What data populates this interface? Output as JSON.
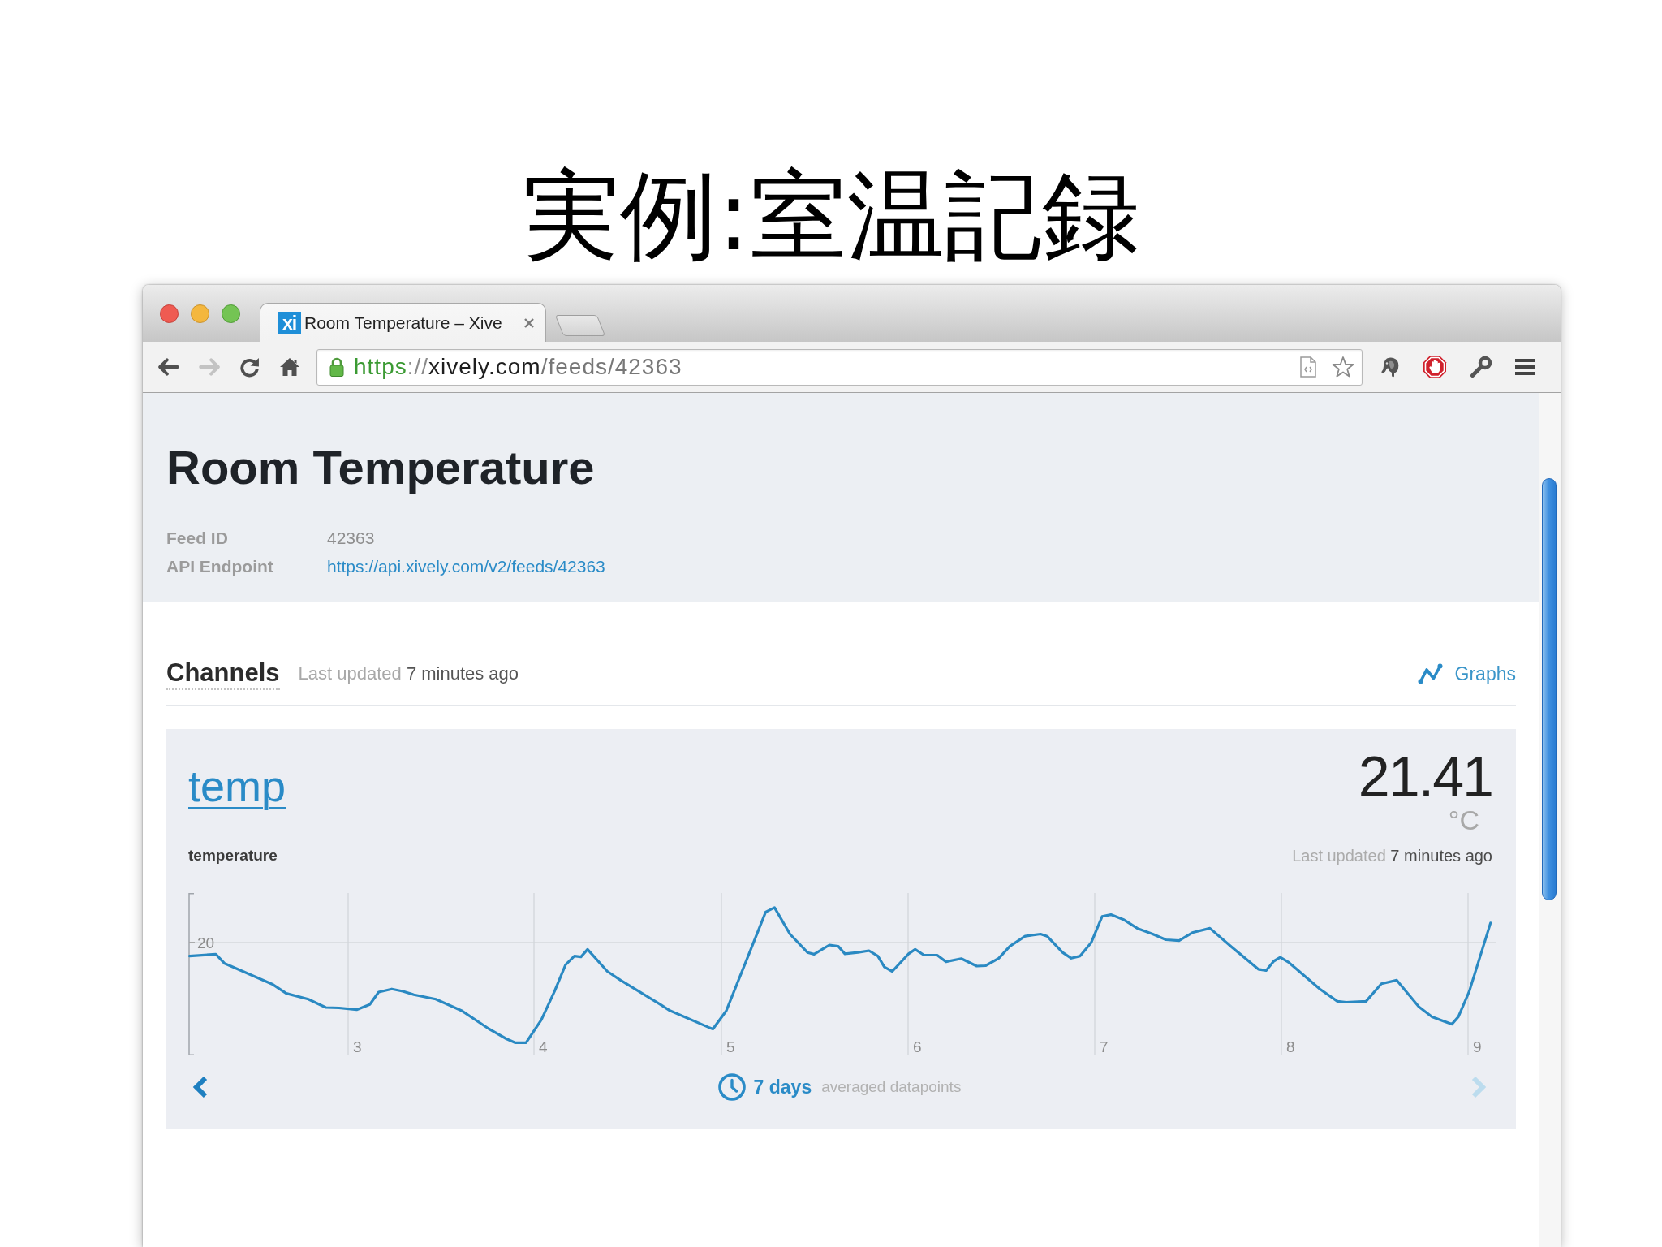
{
  "slide_title": "実例:室温記録",
  "browser": {
    "tabs": [
      {
        "title": "Room Temperature – Xive",
        "favicon": "xi",
        "selected": true
      }
    ],
    "nav_buttons": [
      {
        "kind": "back",
        "disabled": false
      },
      {
        "kind": "forward",
        "disabled": true
      },
      {
        "kind": "reload",
        "disabled": false
      },
      {
        "kind": "home",
        "disabled": false
      }
    ],
    "url_parts": [
      {
        "kind": "scheme",
        "text": "https"
      },
      {
        "kind": "separator",
        "text": "://"
      },
      {
        "kind": "host",
        "text": "xively.com"
      },
      {
        "kind": "path",
        "text": "/feeds/42363"
      }
    ]
  },
  "page": {
    "title": "Room Temperature",
    "fields": [
      {
        "label": "Feed ID",
        "value": "42363",
        "kind": "text"
      },
      {
        "label": "API Endpoint",
        "value": "https://api.xively.com/v2/feeds/42363",
        "kind": "link"
      }
    ],
    "channels_section": {
      "heading": "Channels",
      "updated_label": "Last updated",
      "updated_value": "7 minutes ago",
      "graphs_link": "Graphs"
    },
    "channels": [
      {
        "name": "temp",
        "tag": "temperature",
        "value": "21.41",
        "unit": "°C",
        "updated_label": "Last updated",
        "updated_value": "7 minutes ago",
        "y_tick_labels": [
          "20"
        ],
        "x_tick_labels": [
          "3",
          "4",
          "5",
          "6",
          "7",
          "8",
          "9"
        ],
        "range": "7 days",
        "range_note": "averaged datapoints",
        "nav": [
          {
            "kind": "prev",
            "disabled": false
          },
          {
            "kind": "next",
            "disabled": true
          }
        ]
      }
    ]
  }
}
